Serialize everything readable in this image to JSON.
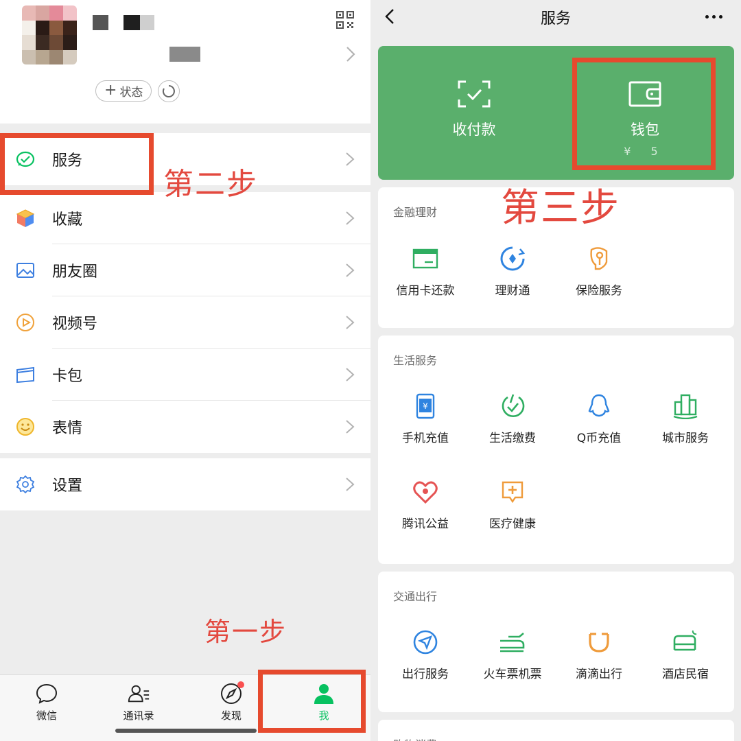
{
  "left": {
    "profile": {
      "status_label": "状态",
      "status_plus": "+"
    },
    "menu": [
      {
        "label": "服务",
        "icon": "service-icon"
      },
      {
        "label": "收藏",
        "icon": "favorites-cube-icon"
      },
      {
        "label": "朋友圈",
        "icon": "moments-image-icon"
      },
      {
        "label": "视频号",
        "icon": "channels-play-icon"
      },
      {
        "label": "卡包",
        "icon": "card-wallet-icon"
      },
      {
        "label": "表情",
        "icon": "sticker-smile-icon"
      },
      {
        "label": "设置",
        "icon": "settings-gear-icon"
      }
    ],
    "annotations": {
      "step1": "第一步",
      "step2": "第二步"
    },
    "tabbar": [
      {
        "label": "微信",
        "icon": "chat-bubble-icon",
        "active": false
      },
      {
        "label": "通讯录",
        "icon": "contacts-icon",
        "active": false
      },
      {
        "label": "发现",
        "icon": "compass-icon",
        "active": false,
        "badge": true
      },
      {
        "label": "我",
        "icon": "person-icon",
        "active": true
      }
    ]
  },
  "right": {
    "nav": {
      "title": "服务"
    },
    "wallet_card": {
      "pay": {
        "label": "收付款",
        "icon": "scan-check-icon"
      },
      "wallet": {
        "label": "钱包",
        "sub": "¥  5",
        "icon": "wallet-icon"
      }
    },
    "annotation_step3": "第三步",
    "sections": [
      {
        "title": "金融理财",
        "items": [
          {
            "label": "信用卡还款",
            "icon": "credit-card-icon"
          },
          {
            "label": "理财通",
            "icon": "wealth-icon"
          },
          {
            "label": "保险服务",
            "icon": "insurance-icon"
          }
        ]
      },
      {
        "title": "生活服务",
        "items": [
          {
            "label": "手机充值",
            "icon": "phone-topup-icon"
          },
          {
            "label": "生活缴费",
            "icon": "utility-bill-icon"
          },
          {
            "label": "Q币充值",
            "icon": "qq-coin-icon"
          },
          {
            "label": "城市服务",
            "icon": "city-service-icon"
          },
          {
            "label": "腾讯公益",
            "icon": "charity-heart-icon"
          },
          {
            "label": "医疗健康",
            "icon": "medical-icon"
          }
        ]
      },
      {
        "title": "交通出行",
        "items": [
          {
            "label": "出行服务",
            "icon": "navigation-icon"
          },
          {
            "label": "火车票机票",
            "icon": "train-icon"
          },
          {
            "label": "滴滴出行",
            "icon": "didi-icon"
          },
          {
            "label": "酒店民宿",
            "icon": "hotel-bed-icon"
          }
        ]
      },
      {
        "title": "购物消费",
        "items": []
      }
    ]
  },
  "colors": {
    "wechat_green": "#07c160",
    "wallet_card_green": "#5aaf6c",
    "annotation_red": "#e64a2e",
    "badge_red": "#fa5151"
  }
}
